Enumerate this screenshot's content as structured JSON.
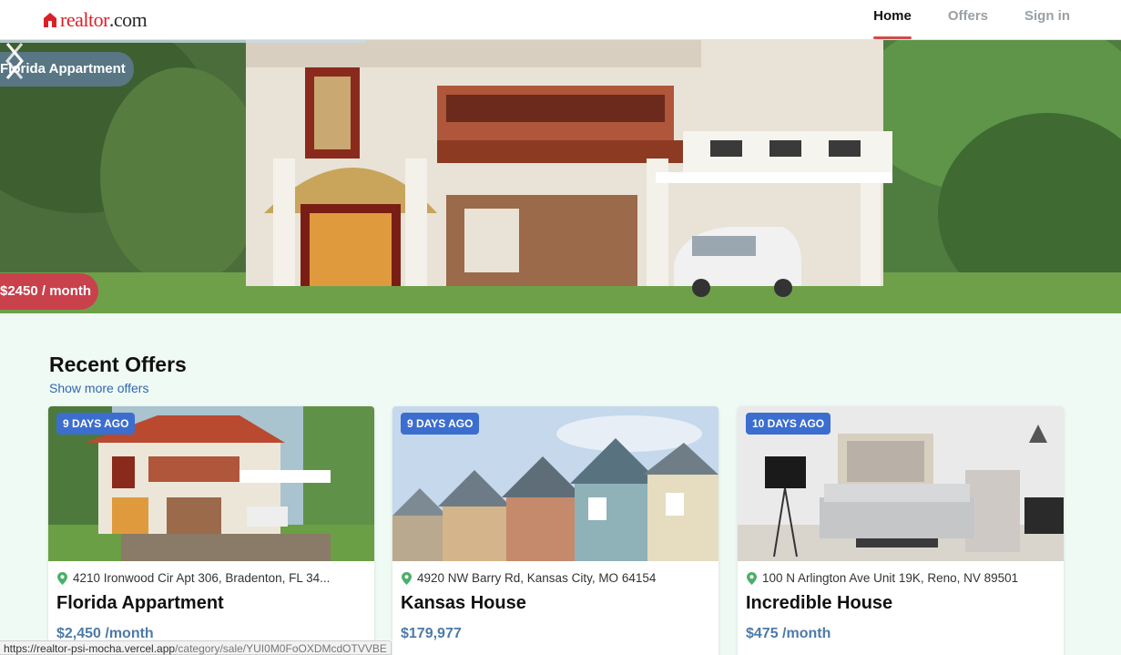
{
  "header": {
    "logo_part1": "realtor",
    "logo_part2": ".com",
    "nav": [
      {
        "label": "Home",
        "active": true
      },
      {
        "label": "Offers",
        "active": false
      },
      {
        "label": "Sign in",
        "active": false
      }
    ]
  },
  "hero": {
    "title": "Florida Appartment",
    "price": "$2450 / month"
  },
  "recent": {
    "title": "Recent Offers",
    "show_more": "Show more offers"
  },
  "cards": [
    {
      "badge": "9 DAYS AGO",
      "address": "4210 Ironwood Cir Apt 306, Bradenton, FL 34...",
      "title": "Florida Appartment",
      "price": "$2,450 /month"
    },
    {
      "badge": "9 DAYS AGO",
      "address": "4920 NW Barry Rd, Kansas City, MO 64154",
      "title": "Kansas House",
      "price": "$179,977"
    },
    {
      "badge": "10 DAYS AGO",
      "address": "100 N Arlington Ave Unit 19K, Reno, NV 89501",
      "title": "Incredible House",
      "price": "$475 /month"
    }
  ],
  "status": {
    "url_host": "https://realtor-psi-mocha.vercel.app",
    "url_path": "/category/sale/YUI0M0FoOXDMcdOTVVBE"
  },
  "colors": {
    "brand_red": "#d92228",
    "badge_blue": "#3b6ecf",
    "price_blue": "#4d7aa8",
    "link_blue": "#2f68b0",
    "page_bg": "#f0faf4"
  },
  "icons": [
    "house-logo-icon",
    "chevron-left-icon",
    "chevron-right-icon",
    "location-pin-icon"
  ]
}
